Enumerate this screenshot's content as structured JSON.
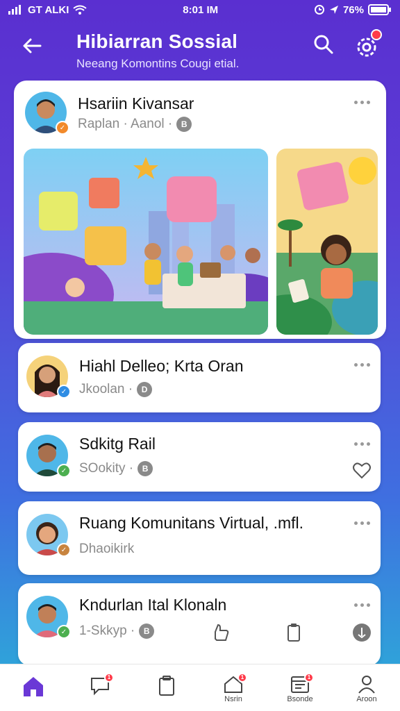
{
  "status": {
    "left": "GT ALKI",
    "time": "8:01 IM",
    "right": "76%"
  },
  "header": {
    "title": "Hibiarran Sossial",
    "subtitle": "Neeang Komontins Cougi etial."
  },
  "posts": [
    {
      "name": "Hsariin Kivansar",
      "meta": "Raplan · Aanol ·",
      "meta_icon": "B",
      "badge_color": "#f28a2b"
    },
    {
      "name": "Hiahl Delleo; Krta Oran",
      "meta": "Jkoolan ·",
      "meta_icon": "D",
      "badge_color": "#2f8de4"
    },
    {
      "name": "Sdkitg Rail",
      "meta": "SOokity ·",
      "meta_icon": "B",
      "badge_color": "#4caf50"
    },
    {
      "name": "Ruang Komunitans Virtual, .mfl.",
      "meta": "Dhaoikirk",
      "meta_icon": "",
      "badge_color": "#c8843f"
    },
    {
      "name": "Kndurlan Ital Klonaln",
      "meta": "1-Skkyp ·",
      "meta_icon": "B",
      "badge_color": "#4caf50"
    }
  ],
  "nav": [
    {
      "icon": "home-icon",
      "label": "",
      "active": true
    },
    {
      "icon": "chat-icon",
      "label": "",
      "dot": "1"
    },
    {
      "icon": "clipboard-icon",
      "label": ""
    },
    {
      "icon": "home-outline-icon",
      "label": "Nsrin",
      "dot": "1"
    },
    {
      "icon": "calendar-icon",
      "label": "Bsonde",
      "dot": "1"
    },
    {
      "icon": "profile-icon",
      "label": "Aroon"
    }
  ],
  "colors": {
    "accent": "#6a38d6",
    "header_gradient_top": "#5a2fd0",
    "header_gradient_bottom": "#2bb0d8",
    "notification": "#ff3b4a"
  }
}
